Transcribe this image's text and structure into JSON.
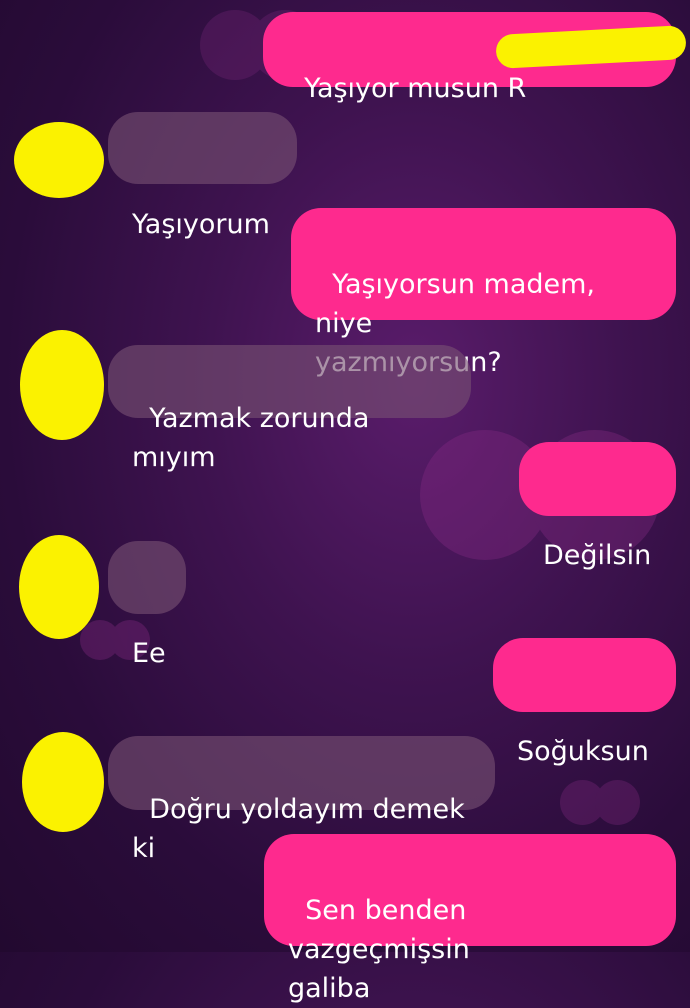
{
  "colors": {
    "outgoing_bubble": "#fe2a8e",
    "incoming_bubble": "#6e4a6d",
    "redaction": "#fbf200"
  },
  "messages": [
    {
      "direction": "out",
      "text": "Yaşıyor musun R"
    },
    {
      "direction": "in",
      "text": "Yaşıyorum"
    },
    {
      "direction": "out",
      "text": "Yaşıyorsun madem, niye\nyazmıyorsun?"
    },
    {
      "direction": "in",
      "text": "Yazmak zorunda mıyım"
    },
    {
      "direction": "out",
      "text": "Değilsin"
    },
    {
      "direction": "in",
      "text": "Ee"
    },
    {
      "direction": "out",
      "text": "Soğuksun"
    },
    {
      "direction": "in",
      "text": "Doğru yoldayım demek ki"
    },
    {
      "direction": "out",
      "text": "Sen benden vazgeçmişsin\ngaliba"
    }
  ]
}
